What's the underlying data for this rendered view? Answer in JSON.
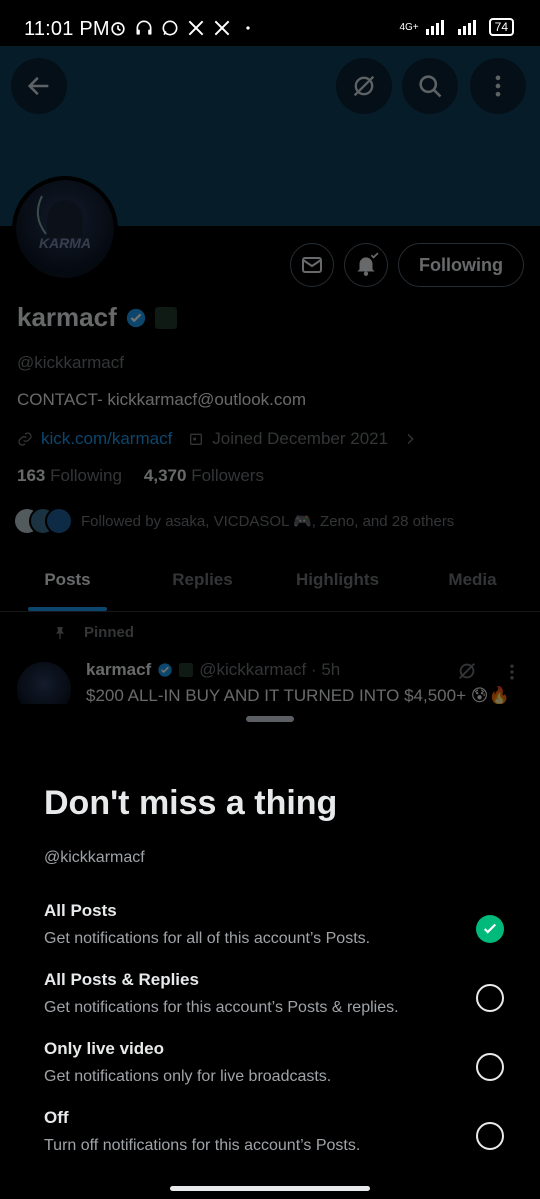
{
  "status_bar": {
    "time": "11:01 PM",
    "network": "4G+",
    "battery": "74"
  },
  "profile": {
    "name": "karmacf",
    "handle": "@kickkarmacf",
    "bio": "CONTACT- kickkarmacf@outlook.com",
    "link": "kick.com/karmacf",
    "joined": "Joined December 2021",
    "following_count": "163",
    "following_label": "Following",
    "followers_count": "4,370",
    "followers_label": "Followers",
    "followed_by": "Followed by asaka, VICDASOL 🎮, Zeno, and 28 others",
    "follow_button": "Following",
    "avatar_text": "KARMA"
  },
  "tabs": [
    "Posts",
    "Replies",
    "Highlights",
    "Media"
  ],
  "pinned_post": {
    "pinned_label": "Pinned",
    "author": "karmacf",
    "handle_time": "@kickkarmacf · 5h",
    "text": "$200 ALL-IN BUY AND IT TURNED INTO $4,500+ 😰🔥"
  },
  "sheet": {
    "title": "Don't miss a thing",
    "handle": "@kickkarmacf",
    "options": [
      {
        "title": "All Posts",
        "desc": "Get notifications for all of this account’s Posts.",
        "selected": true
      },
      {
        "title": "All Posts & Replies",
        "desc": "Get notifications for this account’s Posts & replies.",
        "selected": false
      },
      {
        "title": "Only live video",
        "desc": "Get notifications only for live broadcasts.",
        "selected": false
      },
      {
        "title": "Off",
        "desc": "Turn off notifications for this account’s Posts.",
        "selected": false
      }
    ]
  },
  "colors": {
    "accent": "#1d9bf0",
    "selected": "#00ba7c",
    "banner": "#0e3f5c"
  }
}
